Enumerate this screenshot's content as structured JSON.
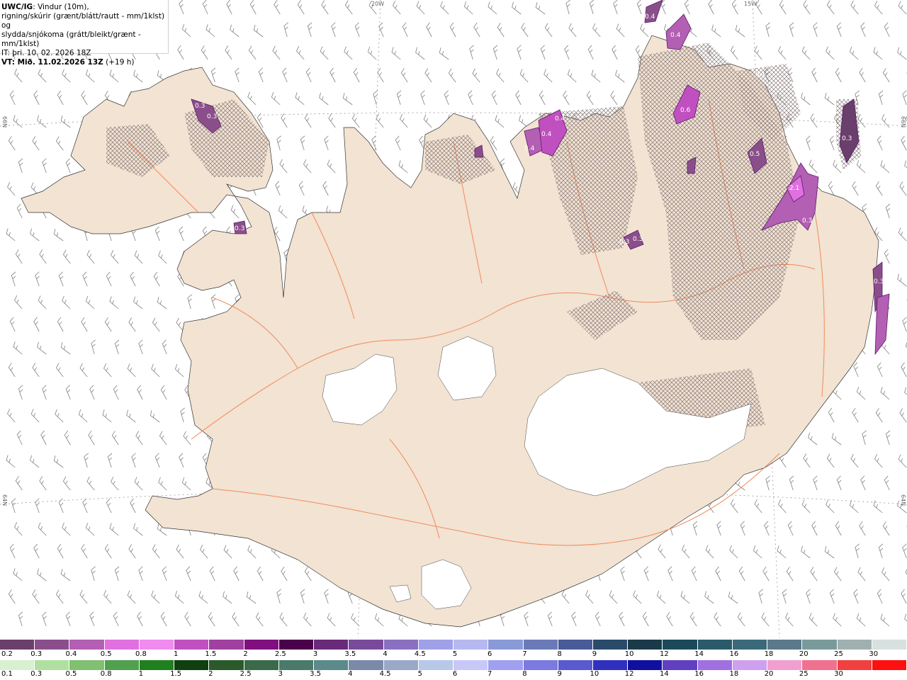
{
  "header": {
    "title_bold": "UWC/IG",
    "title_rest": ": Vindur (10m),",
    "line2": "rigning/skúrir (grænt/blátt/rautt - mm/1klst) og",
    "line3": "slydda/snjókoma (grátt/bleikt/grænt - mm/1klst)",
    "line4": "IT: þri. 10. 02. 2026 18Z",
    "line5_bold": "VT: Mið. 11.02.2026 13Z",
    "line5_rest": " (+19 h)"
  },
  "graticule": {
    "lon_top": [
      "20W",
      "15W"
    ],
    "lat_left": [
      "66N",
      "64N"
    ],
    "lat_right": [
      "66N",
      "64N"
    ]
  },
  "precip_labels": [
    "0.4",
    "0.4",
    "0.3",
    "0.3",
    "0.4",
    "0.4",
    "0.4",
    "0.6",
    "0.5",
    "0.3",
    "2.1",
    "0.3",
    "0.3",
    "0.3",
    "0.3",
    "0.3",
    "0.1"
  ],
  "legend_top": {
    "labels": [
      "0.2",
      "0.3",
      "0.4",
      "0.5",
      "0.8",
      "1",
      "1.5",
      "2",
      "2.5",
      "3",
      "3.5",
      "4",
      "4.5",
      "5",
      "6",
      "7",
      "8",
      "9",
      "10",
      "12",
      "14",
      "16",
      "18",
      "20",
      "25",
      "30"
    ],
    "colors": [
      "#6b3f6b",
      "#8a4f8a",
      "#b35fb3",
      "#e070e0",
      "#f08cf0",
      "#c050c0",
      "#a040a0",
      "#801080",
      "#4a004a",
      "#6a2a7a",
      "#7a4a9a",
      "#8a70c0",
      "#a0a0e8",
      "#b8b8f0",
      "#8a9ad8",
      "#6a7ab8",
      "#4a5a98",
      "#2a4a6a",
      "#1a3a4a",
      "#1a4a5a",
      "#2a5a6a",
      "#3a6a7a",
      "#5a7a8a",
      "#7a9a9a",
      "#a0b0b0",
      "#d8e0e0"
    ]
  },
  "legend_bottom": {
    "labels": [
      "0.1",
      "0.3",
      "0.5",
      "0.8",
      "1",
      "1.5",
      "2",
      "2.5",
      "3",
      "3.5",
      "4",
      "4.5",
      "5",
      "6",
      "7",
      "8",
      "9",
      "10",
      "12",
      "14",
      "16",
      "18",
      "20",
      "25",
      "30"
    ],
    "colors": [
      "#d8f0d0",
      "#b0e0a0",
      "#80c070",
      "#50a050",
      "#208020",
      "#104010",
      "#2a5a2a",
      "#3a6a4a",
      "#4a7a6a",
      "#5a8a8a",
      "#7a8aa8",
      "#9aa8c8",
      "#b8c8e8",
      "#c8c8f8",
      "#a0a0f0",
      "#7a7ae0",
      "#5a5ad0",
      "#3030c0",
      "#1010a0",
      "#6040c0",
      "#a070e0",
      "#d0a0f0",
      "#f0a0d0",
      "#f07090",
      "#f04040",
      "#ff1010"
    ]
  },
  "colors": {
    "land": "#f2e3d3",
    "roads": "#f28a5a",
    "glacier": "#ffffff",
    "snow_hatch": "#8a7a7a",
    "precip_purple": "#9a4aa8",
    "wind_barb": "#808080"
  }
}
